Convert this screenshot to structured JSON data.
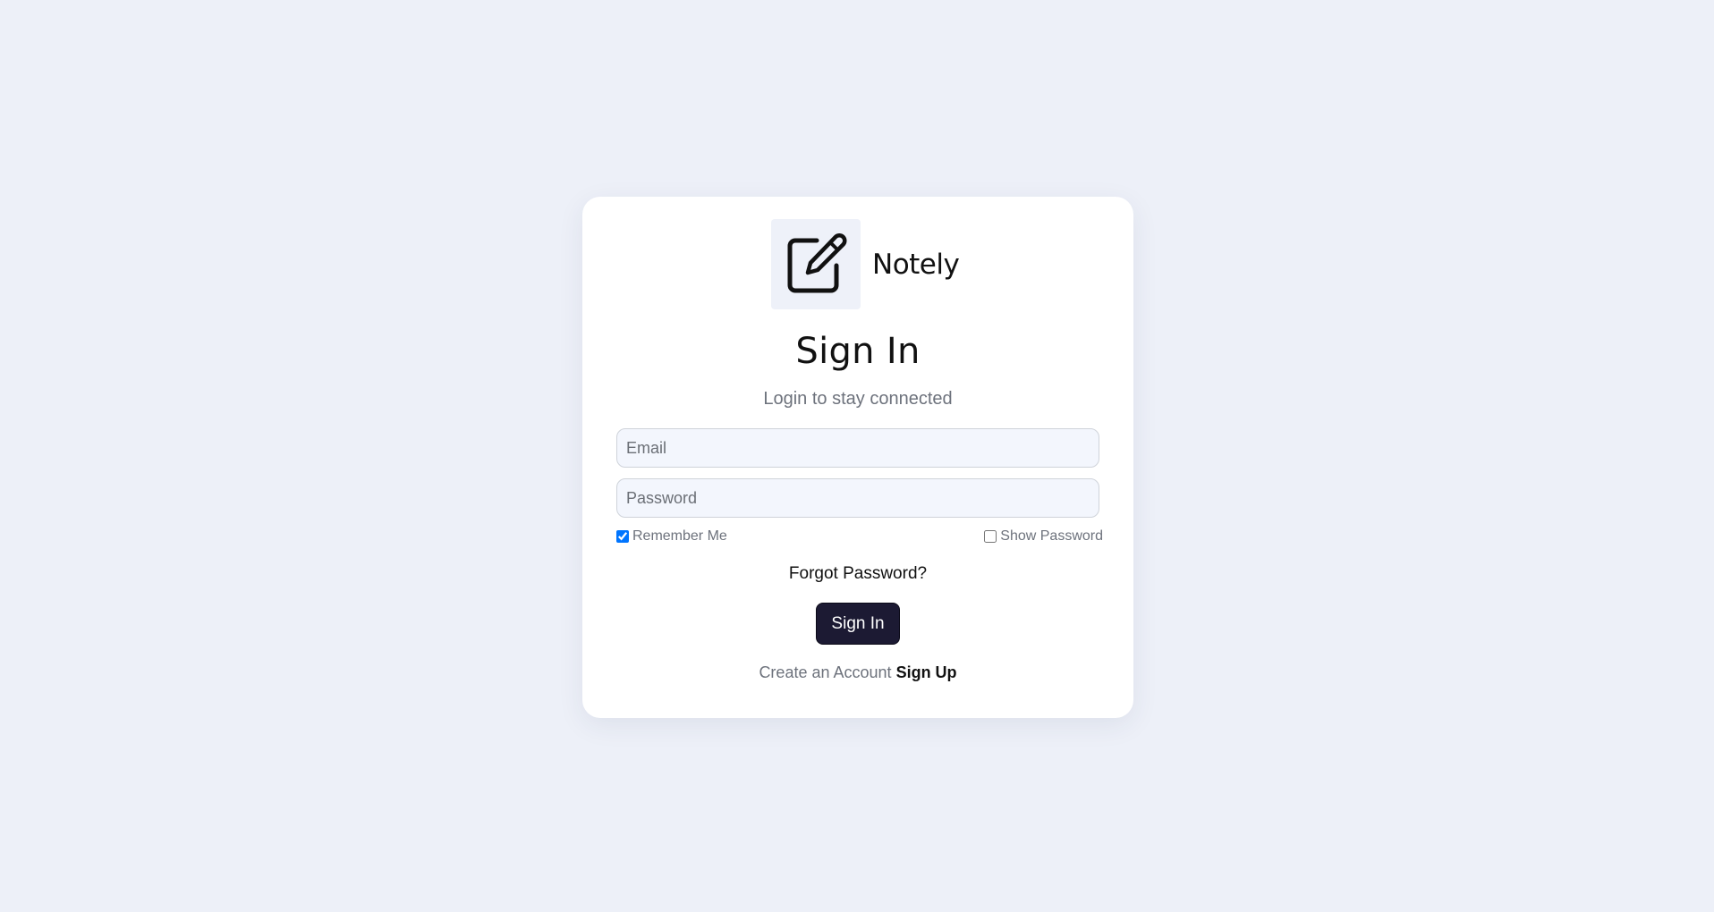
{
  "brand": {
    "name": "Notely",
    "logo_icon": "edit-note-icon"
  },
  "form": {
    "title": "Sign In",
    "subtitle": "Login to stay connected",
    "email_placeholder": "Email",
    "email_value": "",
    "password_placeholder": "Password",
    "password_value": "",
    "remember_label": "Remember Me",
    "remember_checked": true,
    "show_password_label": "Show Password",
    "show_password_checked": false,
    "forgot_label": "Forgot Password?",
    "submit_label": "Sign In"
  },
  "footer": {
    "prompt": "Create an Account",
    "link": "Sign Up"
  },
  "colors": {
    "background": "#edf0f8",
    "card": "#ffffff",
    "button": "#1c1a33",
    "input_bg": "#f3f6fd",
    "muted_text": "#6d727c"
  }
}
